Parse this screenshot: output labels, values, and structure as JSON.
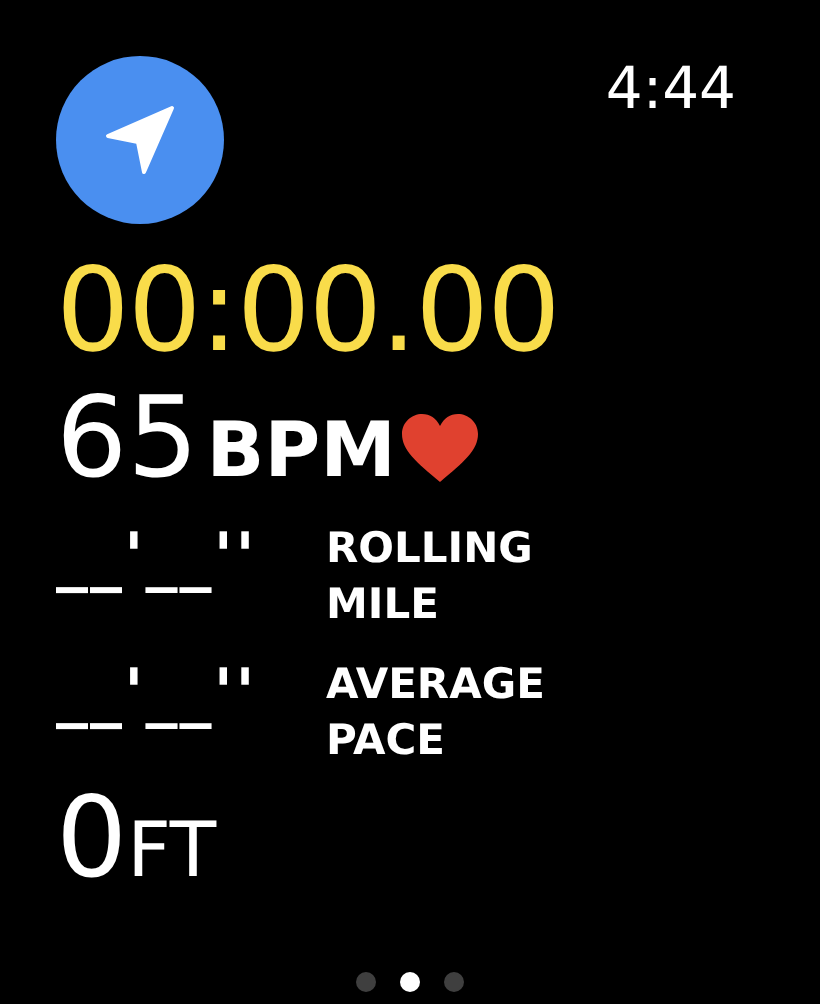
{
  "status": {
    "time": "4:44"
  },
  "workout": {
    "elapsed": "00:00.00",
    "heart_rate": {
      "value": "65",
      "unit": "BPM"
    },
    "metrics": [
      {
        "value": "__'__''",
        "label": "ROLLING MILE"
      },
      {
        "value": "__'__''",
        "label": "AVERAGE PACE"
      }
    ],
    "elevation": {
      "value": "0",
      "unit": "FT"
    }
  },
  "pages": [
    {
      "selected": false
    },
    {
      "selected": true
    },
    {
      "selected": false
    }
  ]
}
